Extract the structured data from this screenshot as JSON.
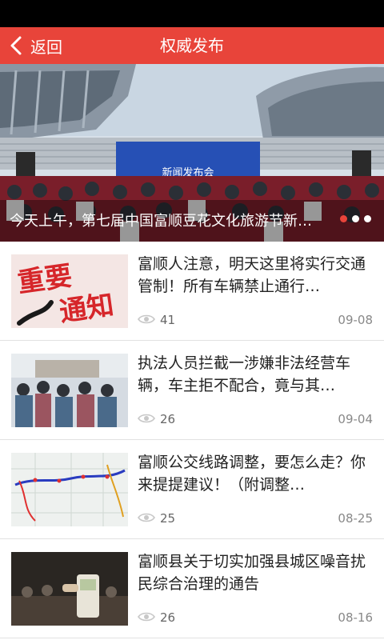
{
  "header": {
    "back_label": "返回",
    "title": "权威发布"
  },
  "banner": {
    "caption": "今天上午，第七届中国富顺豆花文化旅游节新闻发布会",
    "backdrop_text": "新闻发布会",
    "slide_count": 3,
    "active_index": 0
  },
  "news": [
    {
      "title": "富顺人注意，明天这里将实行交通管制！所有车辆禁止通行…",
      "views": "41",
      "date": "09-08",
      "thumb_text": [
        "重要",
        "通知"
      ]
    },
    {
      "title": "执法人员拦截一涉嫌非法经营车辆，车主拒不配合，竟与其…",
      "views": "26",
      "date": "09-04"
    },
    {
      "title": "富顺公交线路调整，要怎么走？你来提提建议！（附调整…",
      "views": "25",
      "date": "08-25"
    },
    {
      "title": "富顺县关于切实加强县城区噪音扰民综合治理的通告",
      "views": "26",
      "date": "08-16"
    }
  ],
  "colors": {
    "accent": "#e8443a",
    "status_bar": "#000000"
  },
  "icons": {
    "back": "chevron-left-icon",
    "views": "eye-icon"
  }
}
